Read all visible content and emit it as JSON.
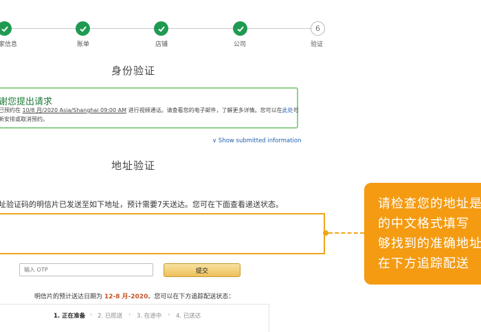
{
  "stepper": {
    "steps": [
      {
        "label": "家信息",
        "status": "done"
      },
      {
        "label": "账单",
        "status": "done"
      },
      {
        "label": "店铺",
        "status": "done"
      },
      {
        "label": "公司",
        "status": "done"
      },
      {
        "label": "验证",
        "status": "pending",
        "number": "6"
      }
    ]
  },
  "identity": {
    "title": "身份验证",
    "confirmation_title": "谢您提出请求",
    "line1_prefix": "已预约在",
    "line1_date": "10/8 月/2020 Asia/Shanghai 09:00 AM",
    "line1_suffix": "进行视频通话。请查看您的电子邮件，了解更多详情。您可以在",
    "line1_link": "此处",
    "line1_end": "可",
    "line2": "新安排或取消预约。",
    "show_link": "∨ Show submitted information"
  },
  "address": {
    "title": "地址验证",
    "description": "址验证码的明信片已发送至如下地址，预计需要7天送达。您可在下面查看递送状态。",
    "otp_placeholder": "输入 OTP",
    "submit_label": "提交",
    "expected_prefix": "明信片的预计送达日期为",
    "expected_date": "12-8 月-2020",
    "expected_suffix": "。您可以在下方追踪配送状态：",
    "tracking_steps": [
      "1. 正在准备",
      "2. 已揽送",
      "3. 在途中",
      "4. 已送达"
    ],
    "tracking_separator": "›"
  },
  "callout": {
    "lines": [
      "请检查您的地址是",
      "的中文格式填写",
      "够找到的准确地址",
      "在下方追踪配送"
    ]
  },
  "colors": {
    "step_done": "#1f9a52",
    "highlight": "#f0a418",
    "link": "#2161b0",
    "date_accent": "#c7511f"
  }
}
